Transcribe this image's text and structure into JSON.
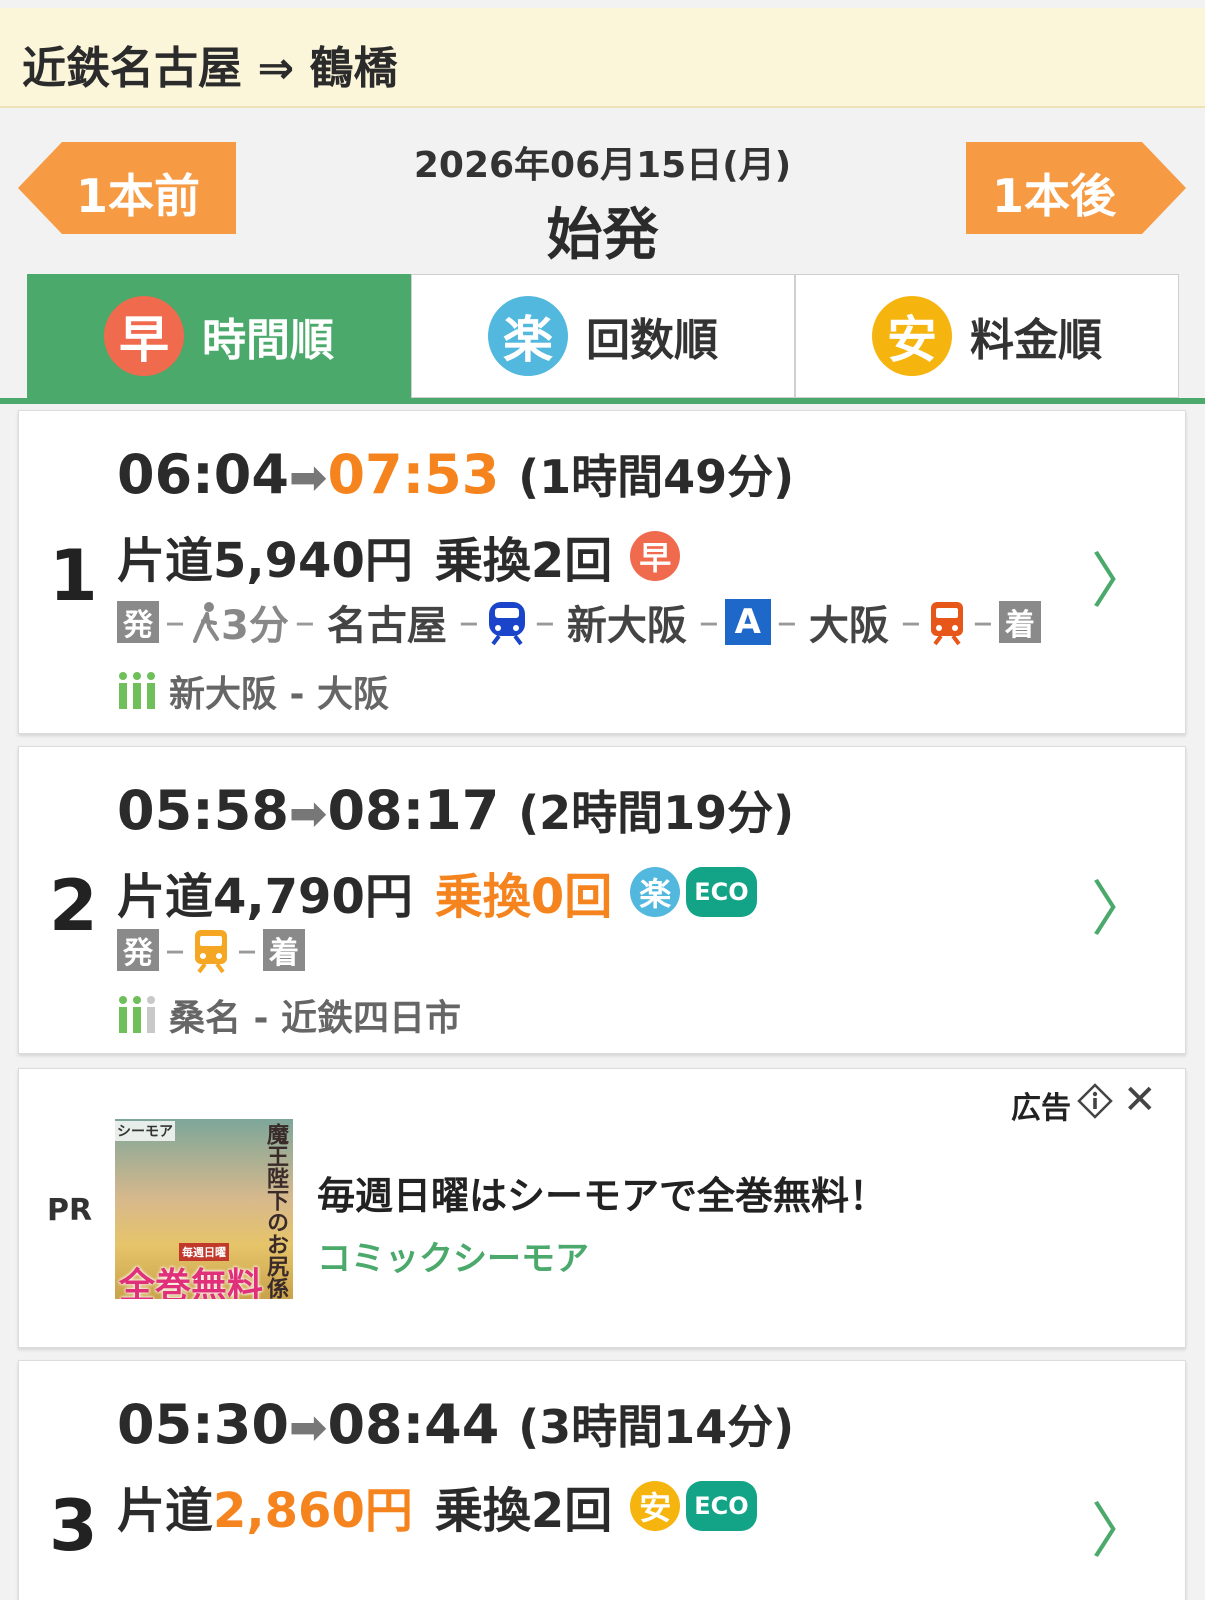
{
  "header": {
    "route": "近鉄名古屋 ⇒ 鶴橋"
  },
  "nav": {
    "prev_label": "1本前",
    "next_label": "1本後",
    "date": "2026年06月15日(月)",
    "first_train": "始発"
  },
  "tabs": [
    {
      "badge": "早",
      "label": "時間順",
      "selected": true,
      "color": "#f06a4d"
    },
    {
      "badge": "楽",
      "label": "回数順",
      "selected": false,
      "color": "#52b8de"
    },
    {
      "badge": "安",
      "label": "料金順",
      "selected": false,
      "color": "#f6b40e"
    }
  ],
  "routes": [
    {
      "rank": "1",
      "depart": "06:04",
      "arrive": "07:53",
      "duration": "(1時間49分)",
      "fare_prefix": "片道",
      "fare": "5,940円",
      "transfers": "乗換2回",
      "badge": "早",
      "eco": "",
      "segments": {
        "start": "発",
        "walk": "3分",
        "st1": "名古屋",
        "st2": "新大阪",
        "a_label": "A",
        "st3": "大阪",
        "end": "着"
      },
      "crowd": "新大阪 - 大阪"
    },
    {
      "rank": "2",
      "depart": "05:58",
      "arrive": "08:17",
      "duration": "(2時間19分)",
      "fare_prefix": "片道",
      "fare": "4,790円",
      "transfers": "乗換0回",
      "badge": "楽",
      "eco": "ECO",
      "segments": {
        "start": "発",
        "end": "着"
      },
      "crowd": "桑名 - 近鉄四日市"
    },
    {
      "rank": "3",
      "depart": "05:30",
      "arrive": "08:44",
      "duration": "(3時間14分)",
      "fare_prefix": "片道",
      "fare": "2,860円",
      "transfers": "乗換2回",
      "badge": "安",
      "eco": "ECO"
    }
  ],
  "ad": {
    "pr": "PR",
    "label": "広告",
    "close": "✕",
    "headline": "毎週日曜はシーモアで全巻無料！",
    "source": "コミックシーモア",
    "image_top": "シーモア",
    "image_title": "魔王陛下のお尻係",
    "image_tag": "毎週日曜",
    "image_big": "全巻無料"
  },
  "colors": {
    "accent_green": "#4aa96b",
    "orange": "#f5841f",
    "nav_orange": "#f79a44",
    "header_bg": "#fbf5da"
  }
}
